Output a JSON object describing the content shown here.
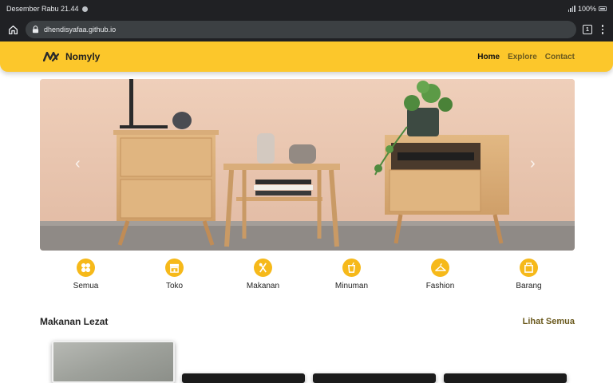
{
  "status": {
    "datetime": "Desember Rabu 21.44",
    "battery": "100%"
  },
  "browser": {
    "url": "dhendisyafaa.github.io",
    "tab_count": "1"
  },
  "navbar": {
    "brand": "Nomyly",
    "links": [
      {
        "label": "Home",
        "active": true
      },
      {
        "label": "Explore",
        "active": false
      },
      {
        "label": "Contact",
        "active": false
      }
    ]
  },
  "hero": {
    "prev_glyph": "‹",
    "next_glyph": "›"
  },
  "categories": [
    {
      "label": "Semua",
      "icon": "grid-icon"
    },
    {
      "label": "Toko",
      "icon": "store-icon"
    },
    {
      "label": "Makanan",
      "icon": "utensils-icon"
    },
    {
      "label": "Minuman",
      "icon": "drink-icon"
    },
    {
      "label": "Fashion",
      "icon": "hanger-icon"
    },
    {
      "label": "Barang",
      "icon": "box-icon"
    }
  ],
  "section": {
    "title": "Makanan Lezat",
    "see_all": "Lihat Semua"
  },
  "colors": {
    "accent": "#fcc72b",
    "icon_bg": "#f6b91a",
    "dark": "#202124"
  }
}
